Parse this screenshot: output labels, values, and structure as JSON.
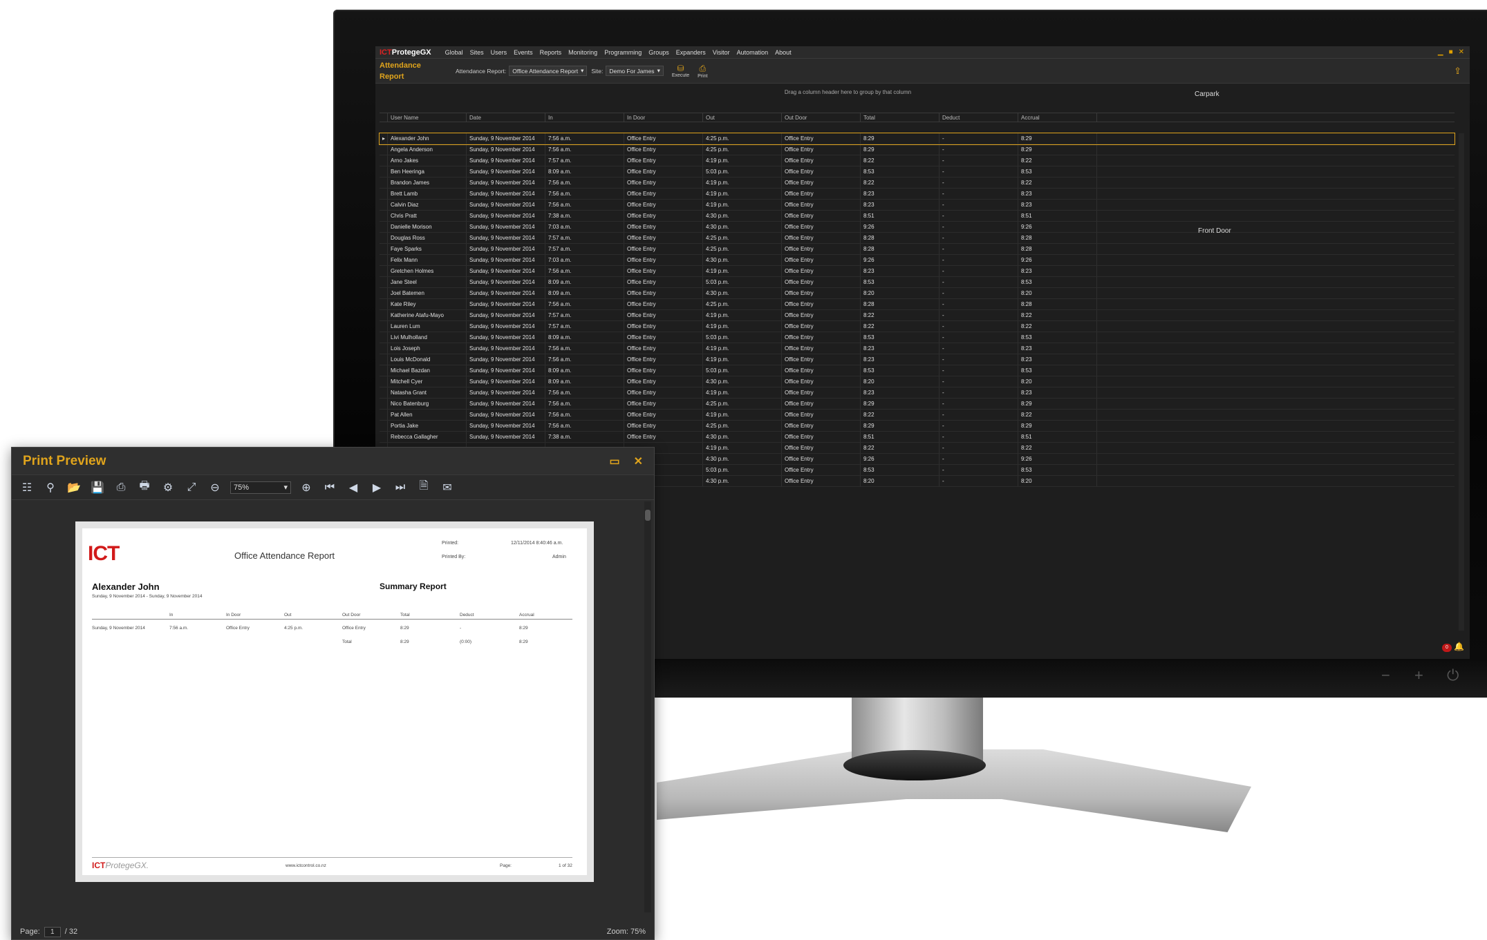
{
  "menubar": {
    "logo_prefix": "ICT",
    "logo_text": "ProtegeGX",
    "items": [
      "Global",
      "Sites",
      "Users",
      "Events",
      "Reports",
      "Monitoring",
      "Programming",
      "Groups",
      "Expanders",
      "Visitor",
      "Automation",
      "About"
    ]
  },
  "toolbar": {
    "title_line1": "Attendance",
    "title_line2": "Report",
    "report_label": "Attendance Report:",
    "report_value": "Office Attendance Report",
    "site_label": "Site:",
    "site_value": "Demo For James",
    "execute_label": "Execute",
    "print_label": "Print"
  },
  "grid": {
    "group_hint": "Drag a column header here to group by that column",
    "overlay_top": "Carpark",
    "overlay_mid": "Front Door",
    "headers": [
      "User Name",
      "Date",
      "In",
      "In Door",
      "Out",
      "Out Door",
      "Total",
      "Deduct",
      "Accrual"
    ],
    "rows": [
      [
        "Alexander John",
        "Sunday, 9 November 2014",
        "7:56 a.m.",
        "Office Entry",
        "4:25 p.m.",
        "Office Entry",
        "8:29",
        "-",
        "8:29"
      ],
      [
        "Angela Anderson",
        "Sunday, 9 November 2014",
        "7:56 a.m.",
        "Office Entry",
        "4:25 p.m.",
        "Office Entry",
        "8:29",
        "-",
        "8:29"
      ],
      [
        "Arno Jakes",
        "Sunday, 9 November 2014",
        "7:57 a.m.",
        "Office Entry",
        "4:19 p.m.",
        "Office Entry",
        "8:22",
        "-",
        "8:22"
      ],
      [
        "Ben Heeringa",
        "Sunday, 9 November 2014",
        "8:09 a.m.",
        "Office Entry",
        "5:03 p.m.",
        "Office Entry",
        "8:53",
        "-",
        "8:53"
      ],
      [
        "Brandon James",
        "Sunday, 9 November 2014",
        "7:56 a.m.",
        "Office Entry",
        "4:19 p.m.",
        "Office Entry",
        "8:22",
        "-",
        "8:22"
      ],
      [
        "Brett Lamb",
        "Sunday, 9 November 2014",
        "7:56 a.m.",
        "Office Entry",
        "4:19 p.m.",
        "Office Entry",
        "8:23",
        "-",
        "8:23"
      ],
      [
        "Calvin Diaz",
        "Sunday, 9 November 2014",
        "7:56 a.m.",
        "Office Entry",
        "4:19 p.m.",
        "Office Entry",
        "8:23",
        "-",
        "8:23"
      ],
      [
        "Chris Pratt",
        "Sunday, 9 November 2014",
        "7:38 a.m.",
        "Office Entry",
        "4:30 p.m.",
        "Office Entry",
        "8:51",
        "-",
        "8:51"
      ],
      [
        "Danielle Morison",
        "Sunday, 9 November 2014",
        "7:03 a.m.",
        "Office Entry",
        "4:30 p.m.",
        "Office Entry",
        "9:26",
        "-",
        "9:26"
      ],
      [
        "Douglas Ross",
        "Sunday, 9 November 2014",
        "7:57 a.m.",
        "Office Entry",
        "4:25 p.m.",
        "Office Entry",
        "8:28",
        "-",
        "8:28"
      ],
      [
        "Faye Sparks",
        "Sunday, 9 November 2014",
        "7:57 a.m.",
        "Office Entry",
        "4:25 p.m.",
        "Office Entry",
        "8:28",
        "-",
        "8:28"
      ],
      [
        "Felix Mann",
        "Sunday, 9 November 2014",
        "7:03 a.m.",
        "Office Entry",
        "4:30 p.m.",
        "Office Entry",
        "9:26",
        "-",
        "9:26"
      ],
      [
        "Gretchen Holmes",
        "Sunday, 9 November 2014",
        "7:56 a.m.",
        "Office Entry",
        "4:19 p.m.",
        "Office Entry",
        "8:23",
        "-",
        "8:23"
      ],
      [
        "Jane Steel",
        "Sunday, 9 November 2014",
        "8:09 a.m.",
        "Office Entry",
        "5:03 p.m.",
        "Office Entry",
        "8:53",
        "-",
        "8:53"
      ],
      [
        "Joel Batemen",
        "Sunday, 9 November 2014",
        "8:09 a.m.",
        "Office Entry",
        "4:30 p.m.",
        "Office Entry",
        "8:20",
        "-",
        "8:20"
      ],
      [
        "Kate Riley",
        "Sunday, 9 November 2014",
        "7:56 a.m.",
        "Office Entry",
        "4:25 p.m.",
        "Office Entry",
        "8:28",
        "-",
        "8:28"
      ],
      [
        "Katherine Atafu-Mayo",
        "Sunday, 9 November 2014",
        "7:57 a.m.",
        "Office Entry",
        "4:19 p.m.",
        "Office Entry",
        "8:22",
        "-",
        "8:22"
      ],
      [
        "Lauren Lum",
        "Sunday, 9 November 2014",
        "7:57 a.m.",
        "Office Entry",
        "4:19 p.m.",
        "Office Entry",
        "8:22",
        "-",
        "8:22"
      ],
      [
        "Livi Mulholland",
        "Sunday, 9 November 2014",
        "8:09 a.m.",
        "Office Entry",
        "5:03 p.m.",
        "Office Entry",
        "8:53",
        "-",
        "8:53"
      ],
      [
        "Lois Joseph",
        "Sunday, 9 November 2014",
        "7:56 a.m.",
        "Office Entry",
        "4:19 p.m.",
        "Office Entry",
        "8:23",
        "-",
        "8:23"
      ],
      [
        "Louis McDonald",
        "Sunday, 9 November 2014",
        "7:56 a.m.",
        "Office Entry",
        "4:19 p.m.",
        "Office Entry",
        "8:23",
        "-",
        "8:23"
      ],
      [
        "Michael Bazdan",
        "Sunday, 9 November 2014",
        "8:09 a.m.",
        "Office Entry",
        "5:03 p.m.",
        "Office Entry",
        "8:53",
        "-",
        "8:53"
      ],
      [
        "Mitchell Cyer",
        "Sunday, 9 November 2014",
        "8:09 a.m.",
        "Office Entry",
        "4:30 p.m.",
        "Office Entry",
        "8:20",
        "-",
        "8:20"
      ],
      [
        "Natasha Grant",
        "Sunday, 9 November 2014",
        "7:56 a.m.",
        "Office Entry",
        "4:19 p.m.",
        "Office Entry",
        "8:23",
        "-",
        "8:23"
      ],
      [
        "Nico Batenburg",
        "Sunday, 9 November 2014",
        "7:56 a.m.",
        "Office Entry",
        "4:25 p.m.",
        "Office Entry",
        "8:29",
        "-",
        "8:29"
      ],
      [
        "Pat Allen",
        "Sunday, 9 November 2014",
        "7:56 a.m.",
        "Office Entry",
        "4:19 p.m.",
        "Office Entry",
        "8:22",
        "-",
        "8:22"
      ],
      [
        "Portia Jake",
        "Sunday, 9 November 2014",
        "7:56 a.m.",
        "Office Entry",
        "4:25 p.m.",
        "Office Entry",
        "8:29",
        "-",
        "8:29"
      ],
      [
        "Rebecca Gallagher",
        "Sunday, 9 November 2014",
        "7:38 a.m.",
        "Office Entry",
        "4:30 p.m.",
        "Office Entry",
        "8:51",
        "-",
        "8:51"
      ],
      [
        "",
        "",
        "",
        "",
        "4:19 p.m.",
        "Office Entry",
        "8:22",
        "-",
        "8:22"
      ],
      [
        "",
        "",
        "",
        "",
        "4:30 p.m.",
        "Office Entry",
        "9:26",
        "-",
        "9:26"
      ],
      [
        "",
        "",
        "",
        "",
        "5:03 p.m.",
        "Office Entry",
        "8:53",
        "-",
        "8:53"
      ],
      [
        "",
        "",
        "",
        "",
        "4:30 p.m.",
        "Office Entry",
        "8:20",
        "-",
        "8:20"
      ]
    ],
    "notification_count": "0"
  },
  "print_preview": {
    "title": "Print Preview",
    "zoom_value": "75%",
    "report": {
      "logo": "ICT",
      "title": "Office Attendance Report",
      "printed_label": "Printed:",
      "printed_value": "12/11/2014 8:40:46 a.m.",
      "printed_by_label": "Printed By:",
      "printed_by_value": "Admin",
      "employee": "Alexander John",
      "date_range": "Sunday, 9 November 2014 - Sunday, 9 November 2014",
      "summary_title": "Summary Report",
      "headers": [
        "",
        "In",
        "In Door",
        "Out",
        "Out Door",
        "Total",
        "Deduct",
        "Accrual"
      ],
      "row": [
        "Sunday, 9 November 2014",
        "7:56 a.m.",
        "Office Entry",
        "4:25 p.m.",
        "Office Entry",
        "8:29",
        "-",
        "8:29"
      ],
      "total_row": [
        "",
        "",
        "",
        "",
        "Total",
        "8:29",
        "(0:00)",
        "8:29"
      ],
      "footer_logo_ict": "ICT",
      "footer_logo_text": "ProtegeGX.",
      "footer_url": "www.ictcontrol.co.nz",
      "footer_page_label": "Page:",
      "footer_page_value": "1 of 32"
    },
    "status": {
      "page_label": "Page:",
      "page_current": "1",
      "page_total": "/ 32",
      "zoom": "Zoom: 75%"
    }
  },
  "colors": {
    "accent": "#e0a41c",
    "brand_red": "#d11a1a",
    "app_bg": "#1e1e1e"
  }
}
